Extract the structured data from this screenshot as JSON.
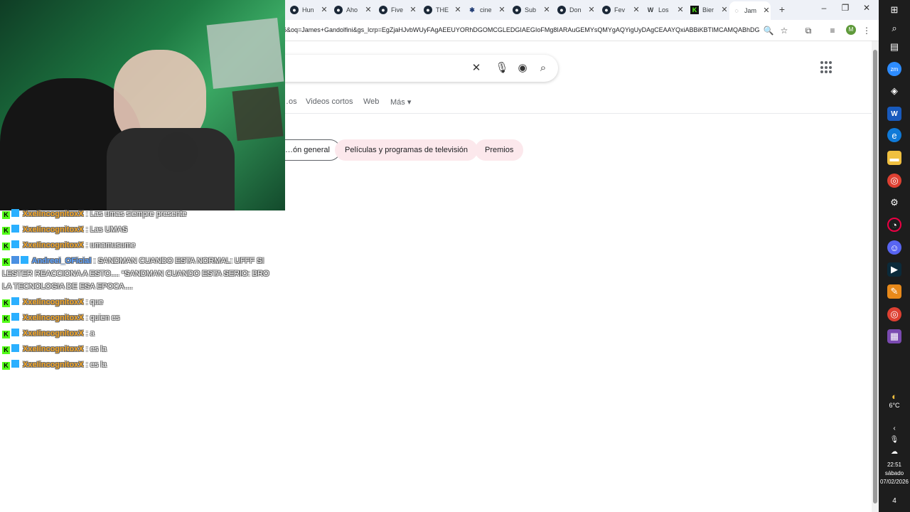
{
  "browser": {
    "tabs": [
      {
        "label": "Hun",
        "icon": "steam-icon"
      },
      {
        "label": "Aho",
        "icon": "steam-icon"
      },
      {
        "label": "Five",
        "icon": "steam-icon"
      },
      {
        "label": "THE",
        "icon": "steam-icon"
      },
      {
        "label": "cine",
        "icon": "network-icon"
      },
      {
        "label": "Sub",
        "icon": "steam-icon"
      },
      {
        "label": "Don",
        "icon": "steam-icon"
      },
      {
        "label": "Fev",
        "icon": "steam-icon"
      },
      {
        "label": "Los",
        "icon": "wikipedia-icon",
        "favicon_text": "W"
      },
      {
        "label": "Bier",
        "icon": "kick-icon",
        "favicon_text": "K"
      },
      {
        "label": "Jam",
        "icon": "google-icon",
        "active": true
      }
    ],
    "new_tab": "+",
    "window_controls": {
      "minimize": "–",
      "restore": "❐",
      "close": "✕"
    },
    "url": "6&oq=James+Gandolfini&gs_lcrp=EgZjaHJvbWUyFAgAEEUYORhDGOMCGLEDGIAEGIoFMg8IARAuGEMYsQMYgAQYigUyDAgCEAAYQxiABBiKBTIMCAMQABhDG...",
    "profile_initial": "M"
  },
  "search": {
    "nav_tabs": [
      "…os",
      "Videos cortos",
      "Web",
      "Más ▾"
    ],
    "chips": [
      "…ón general",
      "Películas y programas de televisión",
      "Premios"
    ]
  },
  "chat": [
    {
      "user": "XxeIincognitoxX",
      "text": ": Las umas siempre presente"
    },
    {
      "user": "XxeIincognitoxX",
      "text": ": Las UMAS"
    },
    {
      "user": "XxeIincognitoxX",
      "text": ": umamusume"
    },
    {
      "user": "Andreei_OFicial",
      "text": ": SANDMAN CUANDO ESTA NORMAL: UFFF SI LESTER REACCIONA A ESTO.... *SANDMAN CUANDO ESTA SERIO: BRO LA TECNOLOGIA DE ESA EPOCA....",
      "blue": true
    },
    {
      "user": "XxeIincognitoxX",
      "text": ": que"
    },
    {
      "user": "XxeIincognitoxX",
      "text": ": quien es"
    },
    {
      "user": "XxeIincognitoxX",
      "text": ": a"
    },
    {
      "user": "XxeIincognitoxX",
      "text": ": es la"
    },
    {
      "user": "XxeIincognitoxX",
      "text": ": es la"
    }
  ],
  "taskbar": {
    "weather_temp": "6°C",
    "time": "22:51",
    "day": "sábado",
    "date": "07/02/2026",
    "notifications": "4"
  }
}
